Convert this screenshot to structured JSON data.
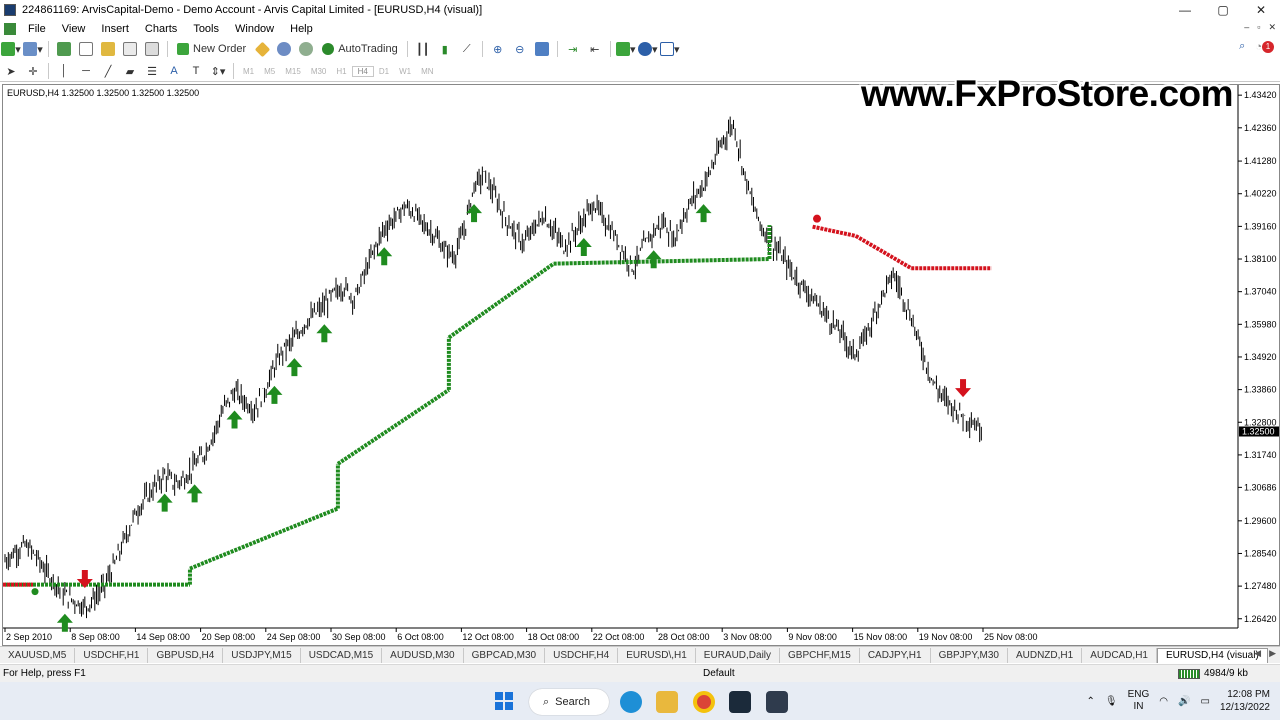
{
  "window": {
    "title": "224861169: ArvisCapital-Demo - Demo Account - Arvis Capital Limited - [EURUSD,H4 (visual)]",
    "minimize": "—",
    "maximize": "▢",
    "close": "✕"
  },
  "menu": [
    "File",
    "View",
    "Insert",
    "Charts",
    "Tools",
    "Window",
    "Help"
  ],
  "toolbar": {
    "new_order": "New Order",
    "autotrading": "AutoTrading",
    "timeframes": [
      "M1",
      "M5",
      "M15",
      "M30",
      "H1",
      "H4",
      "D1",
      "W1",
      "MN"
    ],
    "active_timeframe": "H4",
    "notification_count": "1"
  },
  "chart": {
    "label": "EURUSD,H4  1.32500 1.32500 1.32500 1.32500",
    "watermark": "www.FxProStore.com",
    "current_price": "1.32500",
    "colors": {
      "up": "#1f8b1f",
      "down": "#d4121d",
      "price_tag": "#000000",
      "candles": "#000000"
    }
  },
  "chart_data": {
    "type": "line",
    "symbol": "EURUSD",
    "timeframe": "H4",
    "y_ticks": [
      "1.43420",
      "1.42360",
      "1.41280",
      "1.40220",
      "1.39160",
      "1.38100",
      "1.37040",
      "1.35980",
      "1.34920",
      "1.33860",
      "1.32800",
      "1.31740",
      "1.30686",
      "1.29600",
      "1.28540",
      "1.27480",
      "1.26420"
    ],
    "x_ticks": [
      "2 Sep 2010",
      "8 Sep 08:00",
      "14 Sep 08:00",
      "20 Sep 08:00",
      "24 Sep 08:00",
      "30 Sep 08:00",
      "6 Oct 08:00",
      "12 Oct 08:00",
      "18 Oct 08:00",
      "22 Oct 08:00",
      "28 Oct 08:00",
      "3 Nov 08:00",
      "9 Nov 08:00",
      "15 Nov 08:00",
      "19 Nov 08:00",
      "25 Nov 08:00"
    ],
    "ylim": [
      1.2612,
      1.4362
    ],
    "close": [
      1.283,
      1.286,
      1.288,
      1.285,
      1.28,
      1.276,
      1.272,
      1.27,
      1.268,
      1.271,
      1.275,
      1.282,
      1.29,
      1.298,
      1.303,
      1.307,
      1.311,
      1.308,
      1.31,
      1.314,
      1.318,
      1.325,
      1.333,
      1.338,
      1.335,
      1.332,
      1.338,
      1.346,
      1.352,
      1.355,
      1.36,
      1.363,
      1.366,
      1.37,
      1.372,
      1.368,
      1.376,
      1.384,
      1.391,
      1.394,
      1.398,
      1.396,
      1.392,
      1.389,
      1.384,
      1.382,
      1.39,
      1.405,
      1.408,
      1.402,
      1.395,
      1.39,
      1.386,
      1.391,
      1.395,
      1.39,
      1.385,
      1.389,
      1.394,
      1.399,
      1.394,
      1.389,
      1.383,
      1.378,
      1.385,
      1.39,
      1.393,
      1.387,
      1.395,
      1.401,
      1.405,
      1.412,
      1.42,
      1.425,
      1.41,
      1.398,
      1.39,
      1.386,
      1.381,
      1.376,
      1.372,
      1.368,
      1.364,
      1.36,
      1.356,
      1.35,
      1.354,
      1.362,
      1.37,
      1.376,
      1.369,
      1.36,
      1.35,
      1.341,
      1.336,
      1.333,
      1.33,
      1.328,
      1.325
    ],
    "trailing_stop_up_x": [
      0.0,
      0.15,
      0.15,
      0.27,
      0.27,
      0.36,
      0.36,
      0.445,
      0.445,
      0.62,
      0.62
    ],
    "trailing_stop_up_y": [
      1.2753,
      1.2753,
      1.2805,
      1.3,
      1.3145,
      1.3385,
      1.3555,
      1.3795,
      1.3795,
      1.381,
      1.392
    ],
    "trailing_stop_down_y": [
      1.3915,
      1.3885,
      1.378,
      1.378
    ],
    "buy_arrows_index": [
      6,
      16,
      19,
      23,
      27,
      29,
      32,
      38,
      47,
      58,
      65,
      70
    ],
    "sell_arrows_index": [
      8,
      96
    ],
    "last_price": 1.325
  },
  "tabs": [
    "XAUUSD,M5",
    "USDCHF,H1",
    "GBPUSD,H4",
    "USDJPY,M15",
    "USDCAD,M15",
    "AUDUSD,M30",
    "GBPCAD,M30",
    "USDCHF,H4",
    "EURUSD\\,H1",
    "EURAUD,Daily",
    "GBPCHF,M15",
    "CADJPY,H1",
    "GBPJPY,M30",
    "AUDNZD,H1",
    "AUDCAD,H1",
    "EURUSD,H4 (visual)"
  ],
  "status": {
    "help": "For Help, press F1",
    "profile": "Default",
    "traffic": "4984/9 kb"
  },
  "taskbar": {
    "search_label": "Search",
    "lang_line1": "ENG",
    "lang_line2": "IN",
    "time": "12:08 PM",
    "date": "12/13/2022"
  }
}
